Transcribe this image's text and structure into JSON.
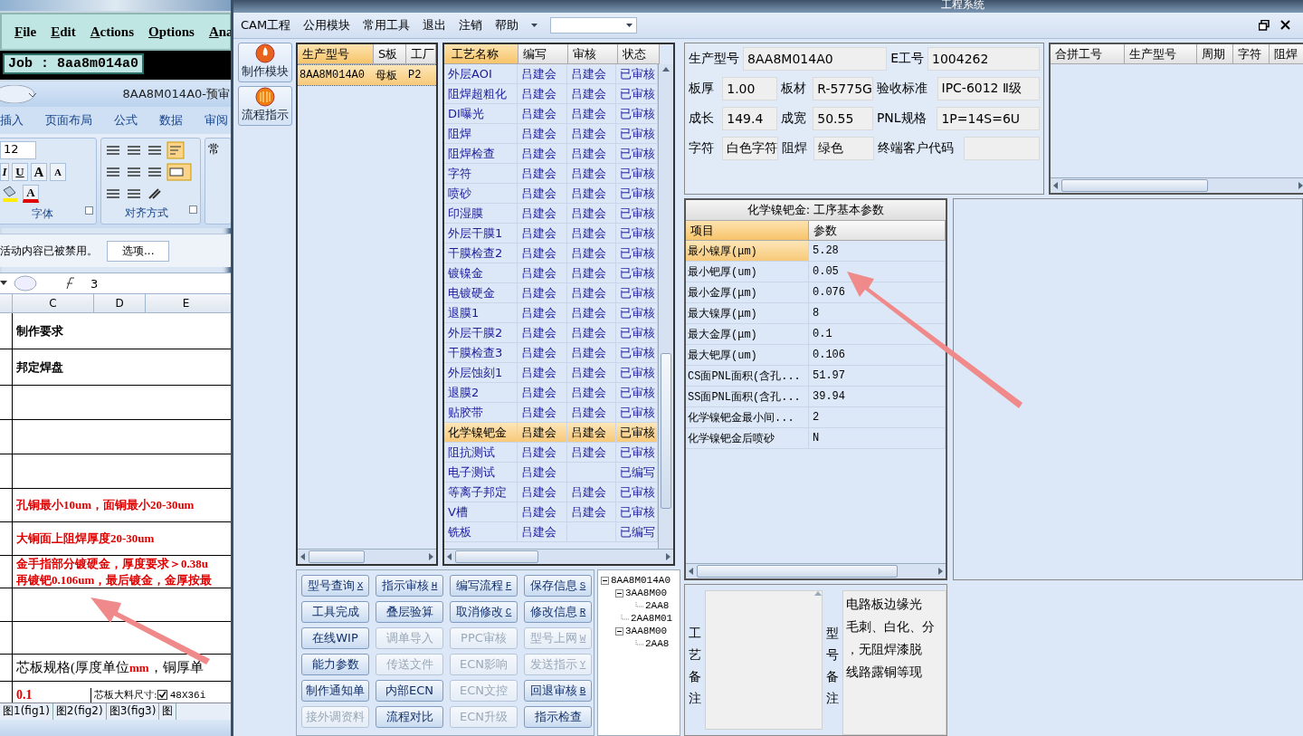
{
  "background_window": {
    "menu": [
      "File",
      "Edit",
      "Actions",
      "Options",
      "Ana"
    ],
    "job": "Job : 8aa8m014a0"
  },
  "spreadsheet": {
    "title": "8AA8M014A0-预审",
    "ribbon_tabs": [
      "插入",
      "页面布局",
      "公式",
      "数据",
      "审阅"
    ],
    "font_size": "12",
    "font_buttons": [
      {
        "label": "I",
        "kind": "italic"
      },
      {
        "label": "U",
        "kind": "underline"
      },
      {
        "label": "A",
        "kind": "grow"
      },
      {
        "label": "A",
        "kind": "shrink"
      },
      {
        "label": "A",
        "kind": "color"
      }
    ],
    "group_labels": [
      "字体",
      "对齐方式"
    ],
    "side_label": "常",
    "security_message": "活动内容已被禁用。",
    "options_button": "选项...",
    "formula_value": "3",
    "columns": [
      "C",
      "D",
      "E"
    ],
    "rows": [
      {
        "kind": "bold",
        "text": "制作要求"
      },
      {
        "kind": "bold",
        "text": "邦定焊盘"
      },
      {
        "kind": "empty"
      },
      {
        "kind": "empty"
      },
      {
        "kind": "empty"
      },
      {
        "kind": "red",
        "text": "孔铜最小10um，面铜最小20-30um"
      },
      {
        "kind": "red",
        "text": "大铜面上阻焊厚度20-30um"
      },
      {
        "kind": "red2",
        "text": "金手指部分镀硬金，厚度要求＞0.38u",
        "text2": "再镀钯0.106um，最后镀金，金厚按最"
      },
      {
        "kind": "empty"
      },
      {
        "kind": "empty"
      },
      {
        "kind": "heading",
        "text": "芯板规格(厚度单位**mm**，铜厚单"
      },
      {
        "kind": "spec",
        "value": "0.1",
        "label": "芯板大料尺寸:",
        "checked": true,
        "size": "48X36i"
      }
    ],
    "sheet_tabs": [
      "图1(fig1)",
      "图2(fig2)",
      "图3(fig3)",
      "图"
    ]
  },
  "cam_window": {
    "title": "工程系统",
    "menu": [
      "CAM工程",
      "公用模块",
      "常用工具",
      "退出",
      "注销",
      "帮助"
    ],
    "nav_buttons": [
      "制作模块",
      "流程指示"
    ],
    "model_list": {
      "columns": [
        "生产型号",
        "S板",
        "工厂"
      ],
      "rows": [
        {
          "cells": [
            "8AA8M014A0",
            "母板",
            "P2"
          ],
          "selected": true
        }
      ]
    },
    "process_list": {
      "columns": [
        "工艺名称",
        "编写",
        "审核",
        "状态"
      ],
      "rows": [
        {
          "cells": [
            "外层AOI",
            "吕建会",
            "吕建会",
            "已审核"
          ],
          "selected": false
        },
        {
          "cells": [
            "阻焊超粗化",
            "吕建会",
            "吕建会",
            "已审核"
          ],
          "selected": false
        },
        {
          "cells": [
            "DI曝光",
            "吕建会",
            "吕建会",
            "已审核"
          ],
          "selected": false
        },
        {
          "cells": [
            "阻焊",
            "吕建会",
            "吕建会",
            "已审核"
          ],
          "selected": false
        },
        {
          "cells": [
            "阻焊检查",
            "吕建会",
            "吕建会",
            "已审核"
          ],
          "selected": false
        },
        {
          "cells": [
            "字符",
            "吕建会",
            "吕建会",
            "已审核"
          ],
          "selected": false
        },
        {
          "cells": [
            "喷砂",
            "吕建会",
            "吕建会",
            "已审核"
          ],
          "selected": false
        },
        {
          "cells": [
            "印湿膜",
            "吕建会",
            "吕建会",
            "已审核"
          ],
          "selected": false
        },
        {
          "cells": [
            "外层干膜1",
            "吕建会",
            "吕建会",
            "已审核"
          ],
          "selected": false
        },
        {
          "cells": [
            "干膜检查2",
            "吕建会",
            "吕建会",
            "已审核"
          ],
          "selected": false
        },
        {
          "cells": [
            "镀镍金",
            "吕建会",
            "吕建会",
            "已审核"
          ],
          "selected": false
        },
        {
          "cells": [
            "电镀硬金",
            "吕建会",
            "吕建会",
            "已审核"
          ],
          "selected": false
        },
        {
          "cells": [
            "退膜1",
            "吕建会",
            "吕建会",
            "已审核"
          ],
          "selected": false
        },
        {
          "cells": [
            "外层干膜2",
            "吕建会",
            "吕建会",
            "已审核"
          ],
          "selected": false
        },
        {
          "cells": [
            "干膜检查3",
            "吕建会",
            "吕建会",
            "已审核"
          ],
          "selected": false
        },
        {
          "cells": [
            "外层蚀刻1",
            "吕建会",
            "吕建会",
            "已审核"
          ],
          "selected": false
        },
        {
          "cells": [
            "退膜2",
            "吕建会",
            "吕建会",
            "已审核"
          ],
          "selected": false
        },
        {
          "cells": [
            "贴胶带",
            "吕建会",
            "吕建会",
            "已审核"
          ],
          "selected": false
        },
        {
          "cells": [
            "化学镍钯金",
            "吕建会",
            "吕建会",
            "已审核"
          ],
          "selected": true
        },
        {
          "cells": [
            "阻抗测试",
            "吕建会",
            "吕建会",
            "已审核"
          ],
          "selected": false
        },
        {
          "cells": [
            "电子测试",
            "吕建会",
            null,
            "已编写"
          ],
          "selected": false
        },
        {
          "cells": [
            "等离子邦定",
            "吕建会",
            "吕建会",
            "已审核"
          ],
          "selected": false
        },
        {
          "cells": [
            "V槽",
            "吕建会",
            "吕建会",
            "已审核"
          ],
          "selected": false
        },
        {
          "cells": [
            "铣板",
            "吕建会",
            null,
            "已编写"
          ],
          "selected": false
        }
      ]
    },
    "buttons": [
      {
        "label": "型号查询",
        "key": "X",
        "disabled": false
      },
      {
        "label": "指示审核",
        "key": "H",
        "disabled": false
      },
      {
        "label": "编写流程",
        "key": "F",
        "disabled": false
      },
      {
        "label": "保存信息",
        "key": "S",
        "disabled": false
      },
      {
        "label": "工具完成",
        "disabled": false
      },
      {
        "label": "叠层验算",
        "disabled": false
      },
      {
        "label": "取消修改",
        "key": "C",
        "disabled": false
      },
      {
        "label": "修改信息",
        "key": "R",
        "disabled": false
      },
      {
        "label": "在线WIP",
        "disabled": false
      },
      {
        "label": "调单导入",
        "disabled": true
      },
      {
        "label": "PPC审核",
        "disabled": true
      },
      {
        "label": "型号上网",
        "key": "W",
        "disabled": true
      },
      {
        "label": "能力参数",
        "disabled": false
      },
      {
        "label": "传送文件",
        "disabled": true
      },
      {
        "label": "ECN影响",
        "disabled": true
      },
      {
        "label": "发送指示",
        "key": "Y",
        "disabled": true
      },
      {
        "label": "制作通知单",
        "disabled": false
      },
      {
        "label": "内部ECN",
        "disabled": false
      },
      {
        "label": "ECN文控",
        "disabled": true
      },
      {
        "label": "回退审核",
        "key": "B",
        "disabled": false
      },
      {
        "label": "接外调资料",
        "disabled": true
      },
      {
        "label": "流程对比",
        "disabled": false
      },
      {
        "label": "ECN升级",
        "disabled": true
      },
      {
        "label": "指示检查",
        "disabled": false
      }
    ],
    "tree": [
      {
        "label": "8AA8M014A0",
        "expanded": true,
        "children": [
          {
            "label": "3AA8M00",
            "expanded": true,
            "children": [
              {
                "label": "2AA8"
              }
            ]
          },
          {
            "label": "2AA8M01"
          },
          {
            "label": "3AA8M00",
            "expanded": true,
            "children": [
              {
                "label": "2AA8"
              }
            ]
          }
        ]
      }
    ],
    "info_fields": [
      [
        {
          "label": "生产型号",
          "value": "8AA8M014A0"
        },
        {
          "label": "E工号",
          "value": "1004262"
        }
      ],
      [
        {
          "label": "板厚",
          "value": "1.00"
        },
        {
          "label": "板材",
          "value": "R-5775G"
        },
        {
          "label": "验收标准",
          "value": "IPC-6012 Ⅱ级"
        }
      ],
      [
        {
          "label": "成长",
          "value": "149.4"
        },
        {
          "label": "成宽",
          "value": "50.55"
        },
        {
          "label": "PNL规格",
          "value": "1P=14S=6U"
        }
      ],
      [
        {
          "label": "字符",
          "value": "白色字符"
        },
        {
          "label": "阻焊",
          "value": "绿色"
        },
        {
          "label": "终端客户代码"
        }
      ]
    ],
    "merge_table": {
      "columns": [
        "合拼工号",
        "生产型号",
        "周期",
        "字符",
        "阻焊"
      ]
    },
    "params": {
      "title": "化学镍钯金: 工序基本参数",
      "columns": [
        "项目",
        "参数"
      ],
      "rows": [
        {
          "item": "最小镍厚(μm)",
          "value": "5.28",
          "selected": true
        },
        {
          "item": "最小钯厚(um)",
          "value": "0.05",
          "selected": false
        },
        {
          "item": "最小金厚(μm)",
          "value": "0.076",
          "selected": false
        },
        {
          "item": "最大镍厚(μm)",
          "value": "8",
          "selected": false
        },
        {
          "item": "最大金厚(μm)",
          "value": "0.1",
          "selected": false
        },
        {
          "item": "最大钯厚(um)",
          "value": "0.106",
          "selected": false
        },
        {
          "item": "CS面PNL面积(含孔...",
          "value": "51.97",
          "selected": false
        },
        {
          "item": "SS面PNL面积(含孔...",
          "value": "39.94",
          "selected": false
        },
        {
          "item": "化学镍钯金最小间...",
          "value": "2",
          "selected": false
        },
        {
          "item": "化学镍钯金后喷砂",
          "value": "N",
          "selected": false
        }
      ]
    },
    "process_remarks": {
      "label": "工艺备注"
    },
    "model_remarks": {
      "label": "型号备注",
      "lines": [
        "电路板边缘光",
        "毛刺、白化、分",
        "，无阻焊漆脱",
        "线路露铜等现"
      ]
    }
  }
}
